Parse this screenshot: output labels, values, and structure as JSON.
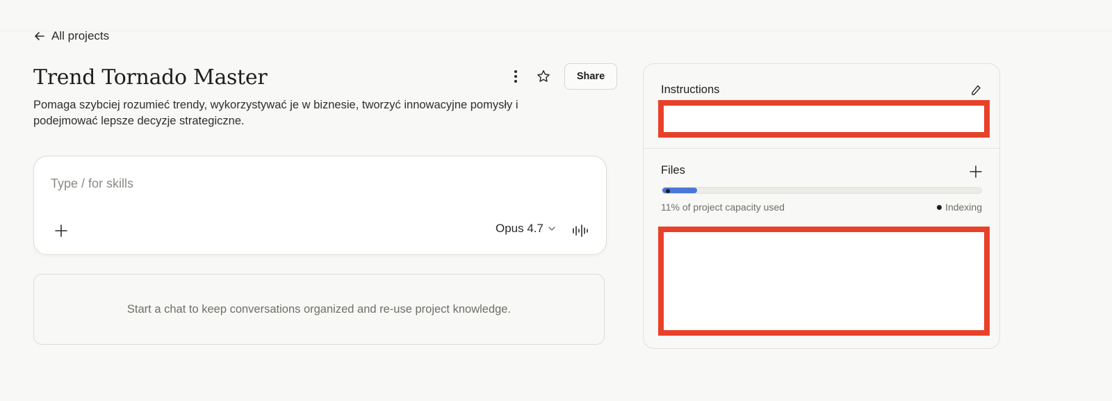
{
  "nav": {
    "back_label": "All projects",
    "back_icon": "arrow-left-icon"
  },
  "project": {
    "title": "Trend Tornado Master",
    "description": "Pomaga szybciej rozumieć trendy, wykorzystywać je w biznesie, tworzyć innowacyjne pomysły i podejmować lepsze decyzje strategiczne.",
    "share_label": "Share"
  },
  "composer": {
    "placeholder": "Type / for skills",
    "model_label": "Opus 4.7"
  },
  "chats": {
    "empty_text": "Start a chat to keep conversations organized and re-use project knowledge."
  },
  "panel": {
    "instructions_title": "Instructions",
    "files_title": "Files",
    "capacity_text": "11% of project capacity used",
    "capacity_fraction": 0.11,
    "indexing_label": "Indexing"
  },
  "colors": {
    "accent": "#4a76d6",
    "redaction": "#e8412a",
    "background": "#f8f8f6"
  }
}
